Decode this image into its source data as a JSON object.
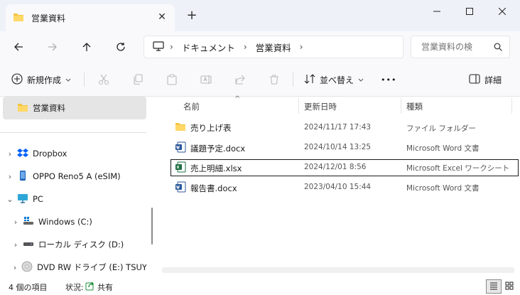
{
  "window": {
    "tab_title": "営業資料",
    "tab_close": "✕",
    "new_tab": "+"
  },
  "address": {
    "breadcrumb": [
      "ドキュメント",
      "営業資料"
    ],
    "sep": "›",
    "search_placeholder": "営業資料の検"
  },
  "toolbar": {
    "new_label": "新規作成",
    "sort_label": "並べ替え",
    "more": "•••",
    "details_label": "詳細"
  },
  "sidebar": {
    "current": "営業資料",
    "items": [
      {
        "label": "Dropbox",
        "icon": "dropbox-icon"
      },
      {
        "label": "OPPO Reno5 A (eSIM)",
        "icon": "phone-icon"
      },
      {
        "label": "PC",
        "icon": "pc-icon"
      },
      {
        "label": "Windows (C:)",
        "icon": "windows-drive-icon"
      },
      {
        "label": "ローカル ディスク (D:)",
        "icon": "drive-icon"
      },
      {
        "label": "DVD RW ドライブ (E:) TSUYAK",
        "icon": "dvd-icon"
      }
    ]
  },
  "columns": {
    "name": "名前",
    "date": "更新日時",
    "type": "種類"
  },
  "files": [
    {
      "name": "売り上げ表",
      "date": "2024/11/17 17:43",
      "type": "ファイル フォルダー",
      "icon": "folder-icon"
    },
    {
      "name": "議題予定.docx",
      "date": "2024/10/14 13:25",
      "type": "Microsoft Word 文書",
      "icon": "word-icon"
    },
    {
      "name": "売上明細.xlsx",
      "date": "2024/12/01 8:56",
      "type": "Microsoft Excel ワークシート",
      "icon": "excel-icon"
    },
    {
      "name": "報告書.docx",
      "date": "2023/04/10 15:44",
      "type": "Microsoft Word 文書",
      "icon": "word-icon"
    }
  ],
  "status": {
    "count": "4 個の項目",
    "state_label": "状況:",
    "shared": "共有"
  },
  "colors": {
    "accent": "#0067c0",
    "folder": "#f4c343",
    "word": "#2b579a",
    "excel": "#1d6f42"
  }
}
